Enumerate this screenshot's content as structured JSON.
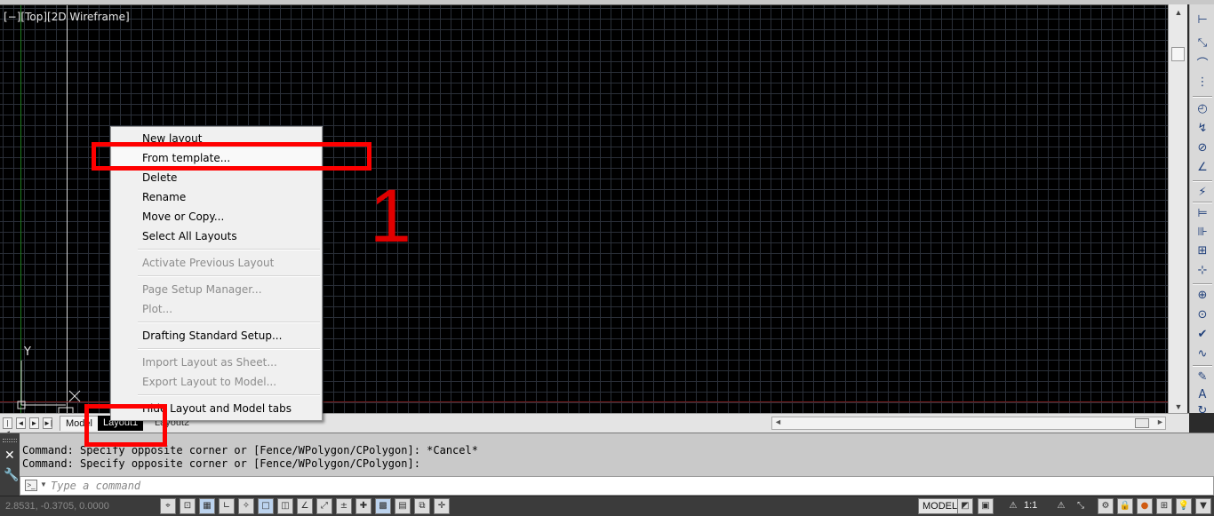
{
  "viewport": {
    "label": "[−][Top][2D Wireframe]",
    "ucs_y_label": "Y"
  },
  "context_menu": {
    "items": [
      {
        "label": "New layout",
        "enabled": true
      },
      {
        "label": "From template...",
        "enabled": true,
        "highlighted": true
      },
      {
        "label": "Delete",
        "enabled": true
      },
      {
        "label": "Rename",
        "enabled": true
      },
      {
        "label": "Move or Copy...",
        "enabled": true
      },
      {
        "label": "Select All Layouts",
        "enabled": true
      },
      {
        "label": "Activate Previous Layout",
        "enabled": false
      },
      {
        "label": "Page Setup Manager...",
        "enabled": false
      },
      {
        "label": "Plot...",
        "enabled": false
      },
      {
        "label": "Drafting Standard Setup...",
        "enabled": true
      },
      {
        "label": "Import Layout as Sheet...",
        "enabled": false
      },
      {
        "label": "Export Layout to Model...",
        "enabled": false
      },
      {
        "label": "Hide Layout and Model tabs",
        "enabled": true
      }
    ]
  },
  "annotation": {
    "step_number": "1",
    "color": "#ff0000"
  },
  "tabs": {
    "nav": [
      "|◄",
      "◄",
      "►",
      "►|"
    ],
    "model": "Model",
    "layout1": "Layout1",
    "layout2": "Layout2"
  },
  "command": {
    "history": [
      "Command: Specify opposite corner or [Fence/WPolygon/CPolygon]: *Cancel*",
      "Command: Specify opposite corner or [Fence/WPolygon/CPolygon]:"
    ],
    "placeholder": "Type a command",
    "close_icon": "close-icon",
    "customize_icon": "wrench-icon"
  },
  "status_bar": {
    "coordinates": "2.8531, -0.3705, 0.0000",
    "model_label": "MODEL",
    "scale_label": "1:1"
  },
  "colors": {
    "viewport_bg": "#000000",
    "grid": "#2a2f38",
    "highlight_box": "#ff0000",
    "active_tab": "#000000"
  }
}
